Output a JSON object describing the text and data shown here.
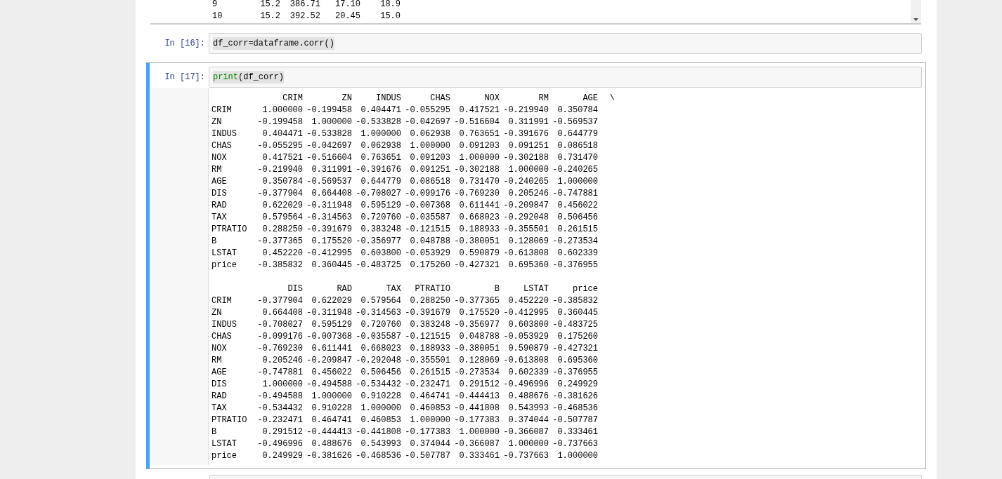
{
  "cells": [
    {
      "kind": "scrolled_output",
      "rows": [
        {
          "index": "9",
          "cells": [
            "15.2",
            "386.71",
            "17.10",
            "18.9"
          ]
        },
        {
          "index": "10",
          "cells": [
            "15.2",
            "392.52",
            "20.45",
            "15.0"
          ]
        }
      ]
    },
    {
      "kind": "code",
      "prompt": "In [16]:",
      "selected": false,
      "code": [
        {
          "text": "df_corr=dataframe.corr()",
          "kind": "plain"
        }
      ]
    },
    {
      "kind": "code",
      "prompt": "In [17]:",
      "selected": true,
      "code": [
        {
          "text": "print",
          "kind": "builtin"
        },
        {
          "text": "(df_corr)",
          "kind": "plain"
        }
      ],
      "output": [
        {
          "columns": [
            "CRIM",
            "ZN",
            "INDUS",
            "CHAS",
            "NOX",
            "RM",
            "AGE"
          ],
          "continuation": "\\",
          "rows": [
            {
              "label": "CRIM",
              "values": [
                "1.000000",
                "-0.199458",
                "0.404471",
                "-0.055295",
                "0.417521",
                "-0.219940",
                "0.350784"
              ]
            },
            {
              "label": "ZN",
              "values": [
                "-0.199458",
                "1.000000",
                "-0.533828",
                "-0.042697",
                "-0.516604",
                "0.311991",
                "-0.569537"
              ]
            },
            {
              "label": "INDUS",
              "values": [
                "0.404471",
                "-0.533828",
                "1.000000",
                "0.062938",
                "0.763651",
                "-0.391676",
                "0.644779"
              ]
            },
            {
              "label": "CHAS",
              "values": [
                "-0.055295",
                "-0.042697",
                "0.062938",
                "1.000000",
                "0.091203",
                "0.091251",
                "0.086518"
              ]
            },
            {
              "label": "NOX",
              "values": [
                "0.417521",
                "-0.516604",
                "0.763651",
                "0.091203",
                "1.000000",
                "-0.302188",
                "0.731470"
              ]
            },
            {
              "label": "RM",
              "values": [
                "-0.219940",
                "0.311991",
                "-0.391676",
                "0.091251",
                "-0.302188",
                "1.000000",
                "-0.240265"
              ]
            },
            {
              "label": "AGE",
              "values": [
                "0.350784",
                "-0.569537",
                "0.644779",
                "0.086518",
                "0.731470",
                "-0.240265",
                "1.000000"
              ]
            },
            {
              "label": "DIS",
              "values": [
                "-0.377904",
                "0.664408",
                "-0.708027",
                "-0.099176",
                "-0.769230",
                "0.205246",
                "-0.747881"
              ]
            },
            {
              "label": "RAD",
              "values": [
                "0.622029",
                "-0.311948",
                "0.595129",
                "-0.007368",
                "0.611441",
                "-0.209847",
                "0.456022"
              ]
            },
            {
              "label": "TAX",
              "values": [
                "0.579564",
                "-0.314563",
                "0.720760",
                "-0.035587",
                "0.668023",
                "-0.292048",
                "0.506456"
              ]
            },
            {
              "label": "PTRATIO",
              "values": [
                "0.288250",
                "-0.391679",
                "0.383248",
                "-0.121515",
                "0.188933",
                "-0.355501",
                "0.261515"
              ]
            },
            {
              "label": "B",
              "values": [
                "-0.377365",
                "0.175520",
                "-0.356977",
                "0.048788",
                "-0.380051",
                "0.128069",
                "-0.273534"
              ]
            },
            {
              "label": "LSTAT",
              "values": [
                "0.452220",
                "-0.412995",
                "0.603800",
                "-0.053929",
                "0.590879",
                "-0.613808",
                "0.602339"
              ]
            },
            {
              "label": "price",
              "values": [
                "-0.385832",
                "0.360445",
                "-0.483725",
                "0.175260",
                "-0.427321",
                "0.695360",
                "-0.376955"
              ]
            }
          ]
        },
        {
          "columns": [
            "DIS",
            "RAD",
            "TAX",
            "PTRATIO",
            "B",
            "LSTAT",
            "price"
          ],
          "rows": [
            {
              "label": "CRIM",
              "values": [
                "-0.377904",
                "0.622029",
                "0.579564",
                "0.288250",
                "-0.377365",
                "0.452220",
                "-0.385832"
              ]
            },
            {
              "label": "ZN",
              "values": [
                "0.664408",
                "-0.311948",
                "-0.314563",
                "-0.391679",
                "0.175520",
                "-0.412995",
                "0.360445"
              ]
            },
            {
              "label": "INDUS",
              "values": [
                "-0.708027",
                "0.595129",
                "0.720760",
                "0.383248",
                "-0.356977",
                "0.603800",
                "-0.483725"
              ]
            },
            {
              "label": "CHAS",
              "values": [
                "-0.099176",
                "-0.007368",
                "-0.035587",
                "-0.121515",
                "0.048788",
                "-0.053929",
                "0.175260"
              ]
            },
            {
              "label": "NOX",
              "values": [
                "-0.769230",
                "0.611441",
                "0.668023",
                "0.188933",
                "-0.380051",
                "0.590879",
                "-0.427321"
              ]
            },
            {
              "label": "RM",
              "values": [
                "0.205246",
                "-0.209847",
                "-0.292048",
                "-0.355501",
                "0.128069",
                "-0.613808",
                "0.695360"
              ]
            },
            {
              "label": "AGE",
              "values": [
                "-0.747881",
                "0.456022",
                "0.506456",
                "0.261515",
                "-0.273534",
                "0.602339",
                "-0.376955"
              ]
            },
            {
              "label": "DIS",
              "values": [
                "1.000000",
                "-0.494588",
                "-0.534432",
                "-0.232471",
                "0.291512",
                "-0.496996",
                "0.249929"
              ]
            },
            {
              "label": "RAD",
              "values": [
                "-0.494588",
                "1.000000",
                "0.910228",
                "0.464741",
                "-0.444413",
                "0.488676",
                "-0.381626"
              ]
            },
            {
              "label": "TAX",
              "values": [
                "-0.534432",
                "0.910228",
                "1.000000",
                "0.460853",
                "-0.441808",
                "0.543993",
                "-0.468536"
              ]
            },
            {
              "label": "PTRATIO",
              "values": [
                "-0.232471",
                "0.464741",
                "0.460853",
                "1.000000",
                "-0.177383",
                "0.374044",
                "-0.507787"
              ]
            },
            {
              "label": "B",
              "values": [
                "0.291512",
                "-0.444413",
                "-0.441808",
                "-0.177383",
                "1.000000",
                "-0.366087",
                "0.333461"
              ]
            },
            {
              "label": "LSTAT",
              "values": [
                "-0.496996",
                "0.488676",
                "0.543993",
                "0.374044",
                "-0.366087",
                "1.000000",
                "-0.737663"
              ]
            },
            {
              "label": "price",
              "values": [
                "0.249929",
                "-0.381626",
                "-0.468536",
                "-0.507787",
                "0.333461",
                "-0.737663",
                "1.000000"
              ]
            }
          ]
        }
      ]
    },
    {
      "kind": "empty_code"
    }
  ]
}
